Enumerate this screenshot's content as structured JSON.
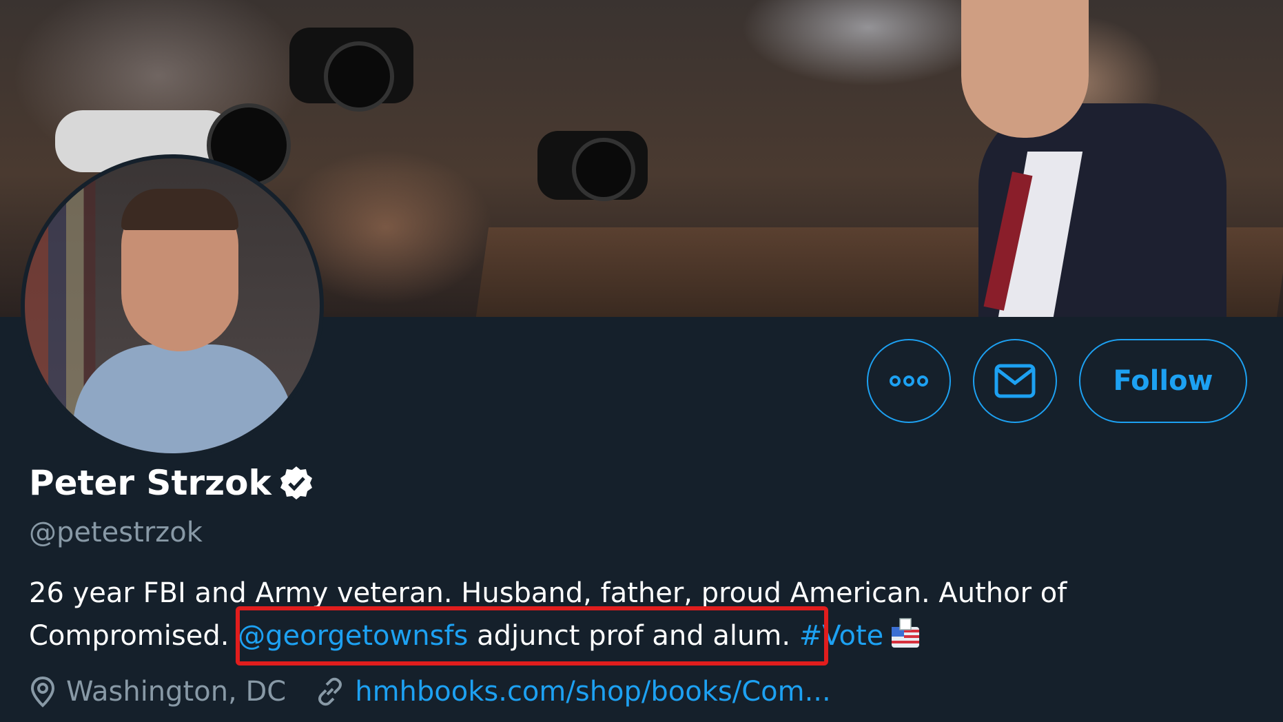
{
  "profile": {
    "name": "Peter Strzok",
    "handle": "@petestrzok",
    "verified_icon": "verified-badge-icon"
  },
  "actions": {
    "more_icon": "more-horizontal-icon",
    "message_icon": "envelope-icon",
    "follow_label": "Follow"
  },
  "bio": {
    "line1": "26 year FBI and Army veteran. Husband, father, proud American. Author of",
    "line2_prefix": "Compromised. ",
    "mention": "@georgetownsfs",
    "line2_middle": " adjunct prof and alum. ",
    "hashtag": "#Vote",
    "emoji_icon": "ballot-box-icon"
  },
  "meta": {
    "location_icon": "location-pin-icon",
    "location": "Washington, DC",
    "link_icon": "link-icon",
    "url": "hmhbooks.com/shop/books/Com..."
  },
  "colors": {
    "background": "#15202b",
    "accent": "#1da1f2",
    "secondary_text": "#8899a6",
    "highlight_box": "#e11d1d"
  }
}
